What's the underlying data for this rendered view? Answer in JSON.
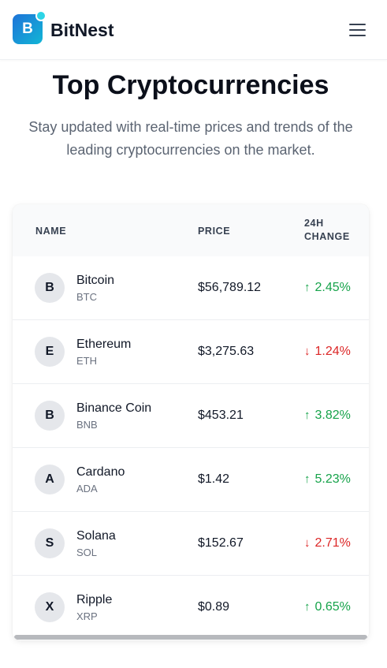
{
  "brand": {
    "logo_letter": "B",
    "name": "BitNest"
  },
  "hero": {
    "title": "Top Cryptocurrencies",
    "subtitle": "Stay updated with real-time prices and trends of the leading cryptocurrencies on the market."
  },
  "table": {
    "headers": {
      "name": "NAME",
      "price": "PRICE",
      "change": "24H CHANGE"
    },
    "rows": [
      {
        "initial": "B",
        "name": "Bitcoin",
        "symbol": "BTC",
        "price": "$56,789.12",
        "change": "2.45%",
        "direction": "up",
        "arrow": "↑"
      },
      {
        "initial": "E",
        "name": "Ethereum",
        "symbol": "ETH",
        "price": "$3,275.63",
        "change": "1.24%",
        "direction": "down",
        "arrow": "↓"
      },
      {
        "initial": "B",
        "name": "Binance Coin",
        "symbol": "BNB",
        "price": "$453.21",
        "change": "3.82%",
        "direction": "up",
        "arrow": "↑"
      },
      {
        "initial": "A",
        "name": "Cardano",
        "symbol": "ADA",
        "price": "$1.42",
        "change": "5.23%",
        "direction": "up",
        "arrow": "↑"
      },
      {
        "initial": "S",
        "name": "Solana",
        "symbol": "SOL",
        "price": "$152.67",
        "change": "2.71%",
        "direction": "down",
        "arrow": "↓"
      },
      {
        "initial": "X",
        "name": "Ripple",
        "symbol": "XRP",
        "price": "$0.89",
        "change": "0.65%",
        "direction": "up",
        "arrow": "↑"
      }
    ]
  },
  "icons": {
    "menu": "hamburger-menu-icon",
    "up": "arrow-up-icon",
    "down": "arrow-down-icon"
  },
  "colors": {
    "up": "#16a34a",
    "down": "#dc2626",
    "brand_start": "#1e73d8",
    "brand_end": "#12b6d6"
  }
}
